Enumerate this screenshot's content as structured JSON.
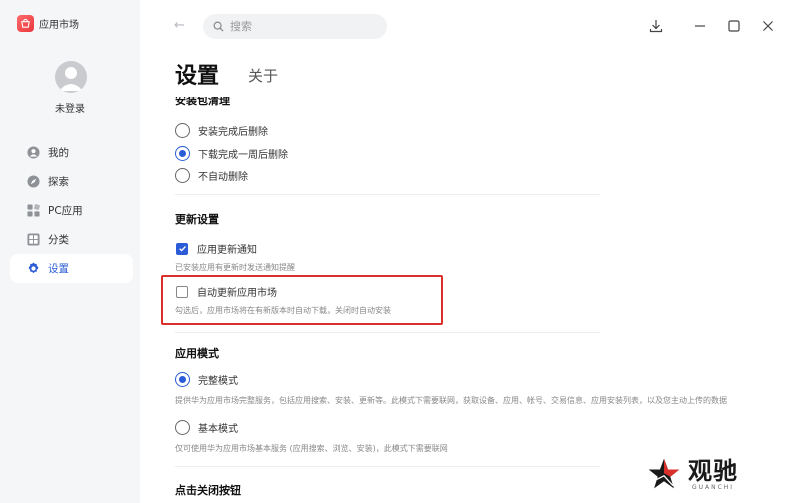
{
  "app": {
    "name": "应用市场"
  },
  "user": {
    "login_status": "未登录"
  },
  "sidebar": {
    "items": [
      {
        "label": "我的",
        "icon": "user-icon",
        "active": false
      },
      {
        "label": "探索",
        "icon": "explore-icon",
        "active": false
      },
      {
        "label": "PC应用",
        "icon": "pc-apps-icon",
        "active": false
      },
      {
        "label": "分类",
        "icon": "category-icon",
        "active": false
      },
      {
        "label": "设置",
        "icon": "settings-gear-icon",
        "active": true
      }
    ]
  },
  "topbar": {
    "search_placeholder": "搜索"
  },
  "tabs": {
    "settings": "设置",
    "about": "关于"
  },
  "sections": {
    "cleanup": {
      "title": "安装包清理",
      "options": [
        {
          "label": "安装完成后删除",
          "checked": false
        },
        {
          "label": "下载完成一周后删除",
          "checked": true
        },
        {
          "label": "不自动删除",
          "checked": false
        }
      ]
    },
    "update": {
      "title": "更新设置",
      "notify_label": "应用更新通知",
      "notify_checked": true,
      "notify_desc": "已安装应用有更新时发送通知提醒",
      "auto_update_label": "自动更新应用市场",
      "auto_update_checked": false,
      "auto_update_desc": "勾选后，应用市场将在有新版本时自动下载，关闭时自动安装"
    },
    "mode": {
      "title": "应用模式",
      "full_label": "完整模式",
      "full_checked": true,
      "full_desc": "提供华为应用市场完整服务，包括应用搜索、安装、更新等。此模式下需要联网，获取设备、应用、帐号、交易信息、应用安装列表，以及您主动上传的数据",
      "basic_label": "基本模式",
      "basic_checked": false,
      "basic_desc": "仅可使用华为应用市场基本服务 (应用搜索、浏览、安装)，此模式下需要联网"
    },
    "close": {
      "title": "点击关闭按钮"
    }
  },
  "watermark": {
    "cn": "观驰",
    "en": "GUANCHI"
  },
  "colors": {
    "accent": "#2b5bd7",
    "highlight": "#d9302c",
    "sidebar_bg": "#f5f6f8"
  }
}
